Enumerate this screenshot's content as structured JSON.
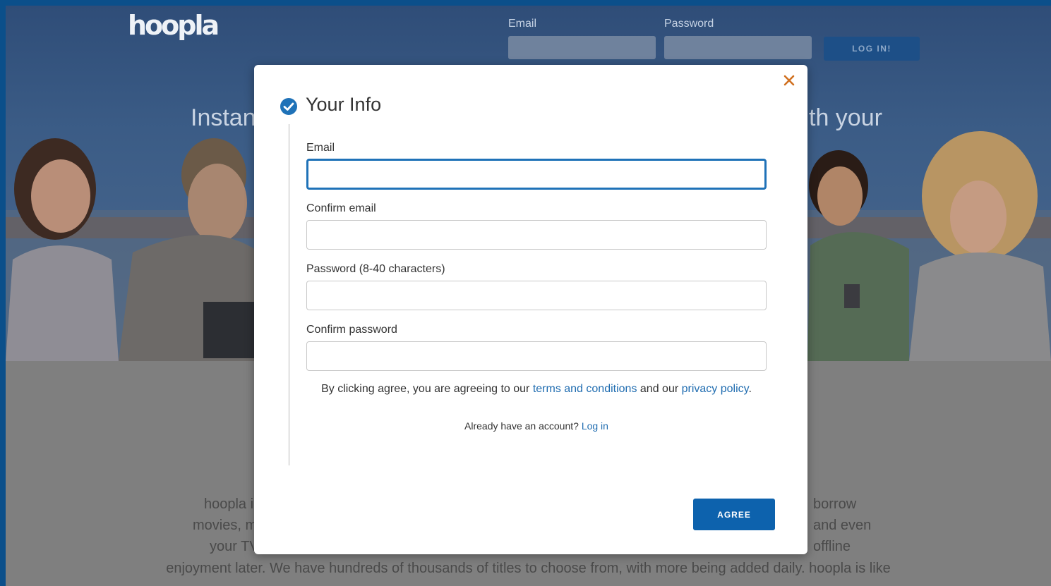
{
  "header": {
    "logo": "hoopla",
    "email_label": "Email",
    "password_label": "Password",
    "login_button": "LOG IN!"
  },
  "hero": {
    "headline_left": "Instant",
    "headline_right": "th your"
  },
  "body_text": {
    "lines": [
      {
        "left": "hoopla i",
        "right": "borrow"
      },
      {
        "left": "movies, m",
        "right": "and even"
      },
      {
        "left": "your TV",
        "right": "offline"
      }
    ],
    "full_line": "enjoyment later. We have hundreds of thousands of titles to choose from, with more being added daily. hoopla is like"
  },
  "modal": {
    "title": "Your Info",
    "close_icon": "close-icon",
    "step_icon": "check-circle-icon",
    "fields": [
      {
        "label": "Email",
        "value": ""
      },
      {
        "label": "Confirm email",
        "value": ""
      },
      {
        "label": "Password (8-40 characters)",
        "value": ""
      },
      {
        "label": "Confirm password",
        "value": ""
      }
    ],
    "terms": {
      "prefix": "By clicking agree, you are agreeing to our ",
      "terms_link": "terms and conditions",
      "middle": " and our ",
      "privacy_link": "privacy policy",
      "suffix": "."
    },
    "already": {
      "text": "Already have an account? ",
      "link": "Log in"
    },
    "agree_button": "AGREE"
  },
  "colors": {
    "accent": "#1f72b8",
    "button": "#0d62ad",
    "close": "#d0701f",
    "frame": "#0b4f8a"
  }
}
